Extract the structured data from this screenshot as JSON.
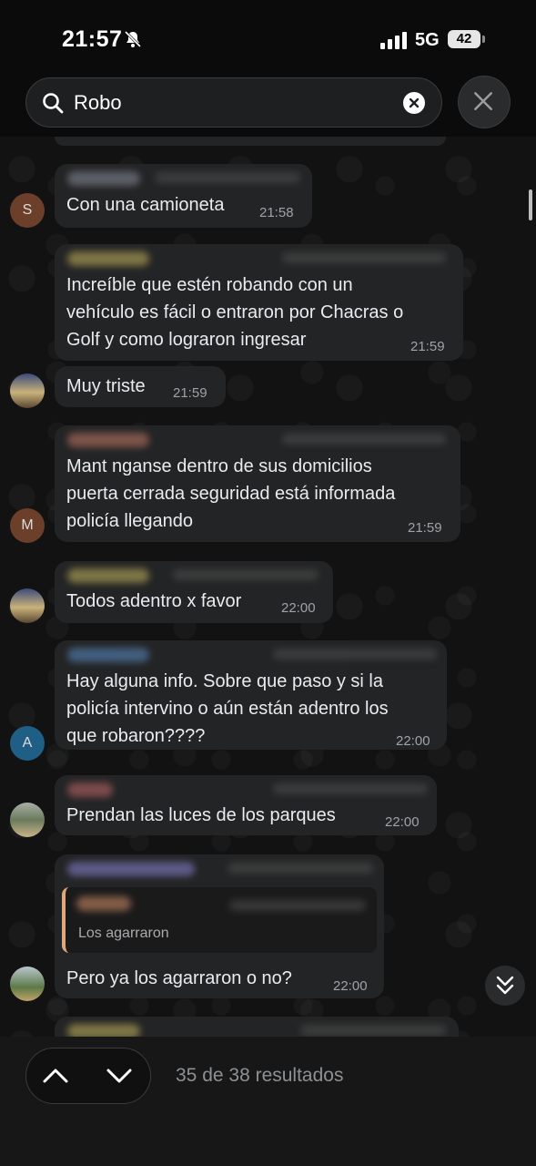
{
  "status_bar": {
    "time": "21:57",
    "network": "5G",
    "battery": "42"
  },
  "search": {
    "query": "Robo"
  },
  "messages": [
    {
      "text": "Con una camioneta",
      "time": "21:58",
      "avatar_letter": "S"
    },
    {
      "text": "Increíble que estén robando con un\nvehículo es fácil o entraron por Chacras o\nGolf y como lograron ingresar",
      "time": "21:59"
    },
    {
      "text": "Muy triste",
      "time": "21:59"
    },
    {
      "text": "Mant nganse dentro de sus domicilios\npuerta cerrada seguridad está informada\npolicía llegando",
      "time": "21:59",
      "avatar_letter": "M"
    },
    {
      "text": "Todos adentro x favor",
      "time": "22:00"
    },
    {
      "text": "Hay alguna info. Sobre que paso y si la\npolicía intervino o aún están adentro los\nque robaron????",
      "time": "22:00",
      "avatar_letter": "A"
    },
    {
      "text": "Prendan las luces de los parques",
      "time": "22:00"
    },
    {
      "text": "Pero ya los agarraron o no?",
      "time": "22:00",
      "quote_text": "Los agarraron"
    }
  ],
  "footer": {
    "results_label": "35 de 38 resultados"
  },
  "colors": {
    "bubble": "#232425",
    "background": "#121212",
    "quote_bar": "#e0a77a"
  }
}
